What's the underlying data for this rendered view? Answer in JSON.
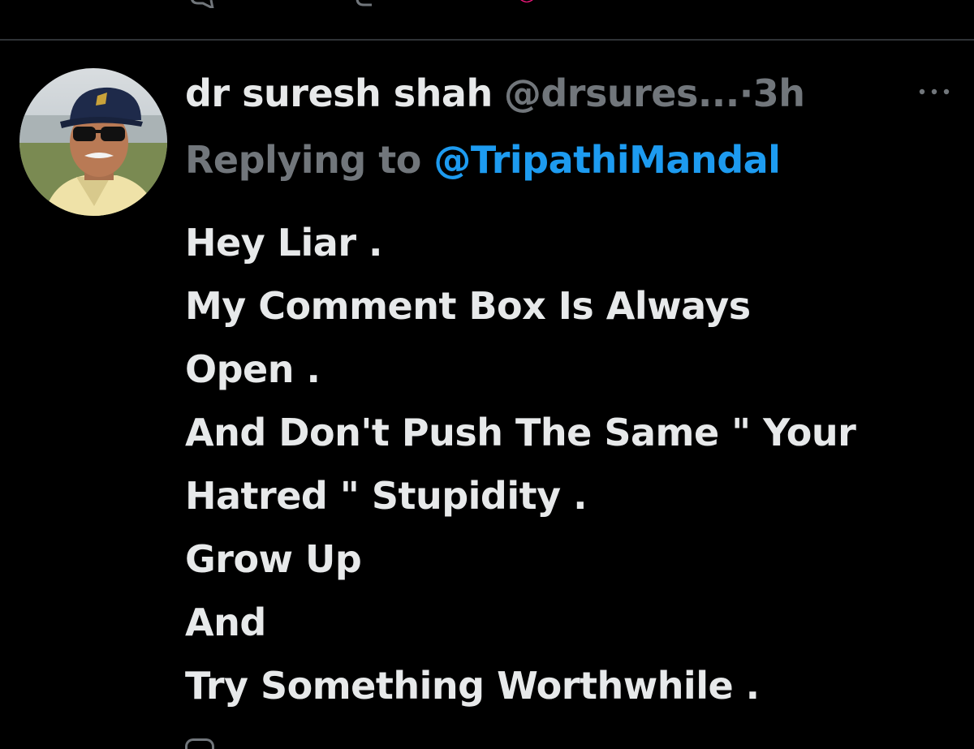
{
  "top_actions": {
    "icons": [
      "reply-icon",
      "retweet-icon",
      "like-icon",
      "views-icon",
      "bookmark-icon"
    ],
    "like_color": "#f91880"
  },
  "tweet": {
    "author": {
      "display_name": "dr suresh shah",
      "handle": "@drsures...",
      "separator": "·",
      "time": "3h"
    },
    "more_icon": "more-icon",
    "reply": {
      "prefix": "Replying to",
      "mention": "@TripathiMandal"
    },
    "body_lines": [
      "Hey Liar .",
      "My Comment Box Is Always",
      "Open .",
      "And Don't Push The Same \" Your",
      "Hatred \" Stupidity .",
      "Grow Up",
      "And",
      "Try Something Worthwhile ."
    ]
  },
  "colors": {
    "background": "#000000",
    "text_primary": "#e7e9ea",
    "text_secondary": "#71767b",
    "link": "#1d9bf0",
    "divider": "#2f3336"
  }
}
